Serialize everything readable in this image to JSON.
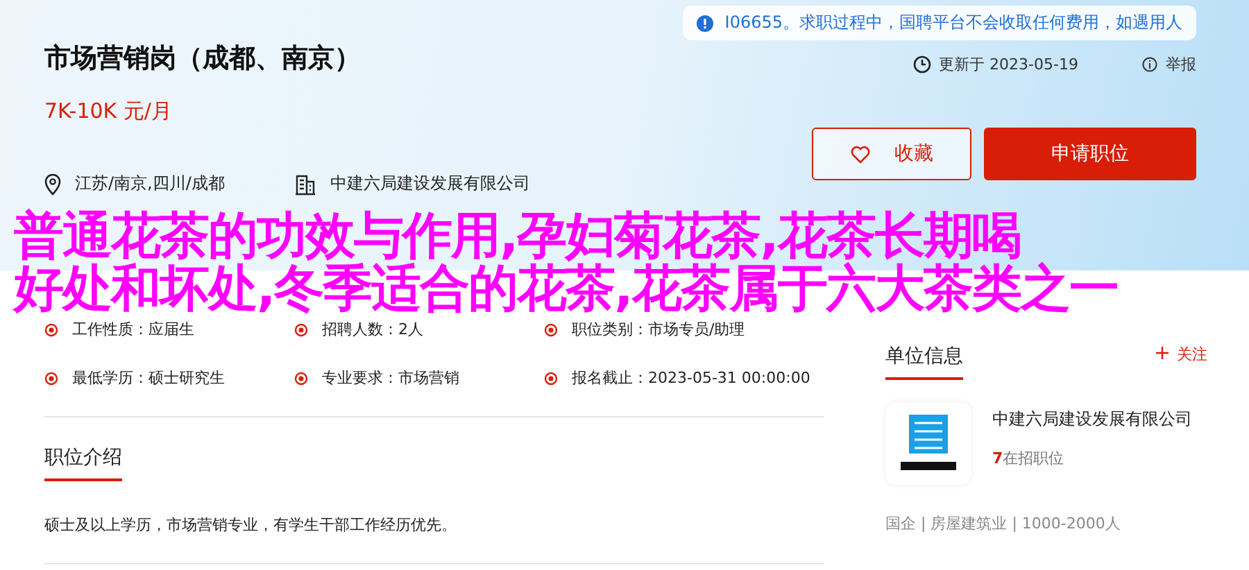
{
  "notice": {
    "text": "I06655。求职过程中，国聘平台不会收取任何费用，如遇用人"
  },
  "job": {
    "title": "市场营销岗（成都、南京）",
    "salary": "7K-10K 元/月",
    "location": "江苏/南京,四川/成都",
    "company": "中建六局建设发展有限公司"
  },
  "updated": "更新于 2023-05-19",
  "report": "举报",
  "buttons": [
    {
      "kind": "outline",
      "label": "收藏"
    },
    {
      "kind": "primary",
      "label": "申请职位"
    }
  ],
  "overlay_headline": [
    "普通花茶的功效与作用,孕妇菊花茶,花茶长期喝",
    "好处和坏处,冬季适合的花茶,花茶属于六大茶类之一"
  ],
  "details": [
    {
      "label": "工作性质：",
      "value": "应届生"
    },
    {
      "label": "招聘人数：",
      "value": "2人"
    },
    {
      "label": "职位类别：",
      "value": "市场专员/助理"
    },
    {
      "label": "最低学历：",
      "value": "硕士研究生"
    },
    {
      "label": "专业要求：",
      "value": "市场营销"
    },
    {
      "label": "报名截止：",
      "value": "2023-05-31 00:00:00"
    }
  ],
  "intro": {
    "heading": "职位介绍",
    "text": "硕士及以上学历，市场营销专业，有学生干部工作经历优先。"
  },
  "employer": {
    "heading": "单位信息",
    "follow": "关注",
    "name": "中建六局建设发展有限公司",
    "open_count": "7",
    "open_label": "在招职位",
    "meta": "国企 | 房屋建筑业 | 1000-2000人"
  }
}
